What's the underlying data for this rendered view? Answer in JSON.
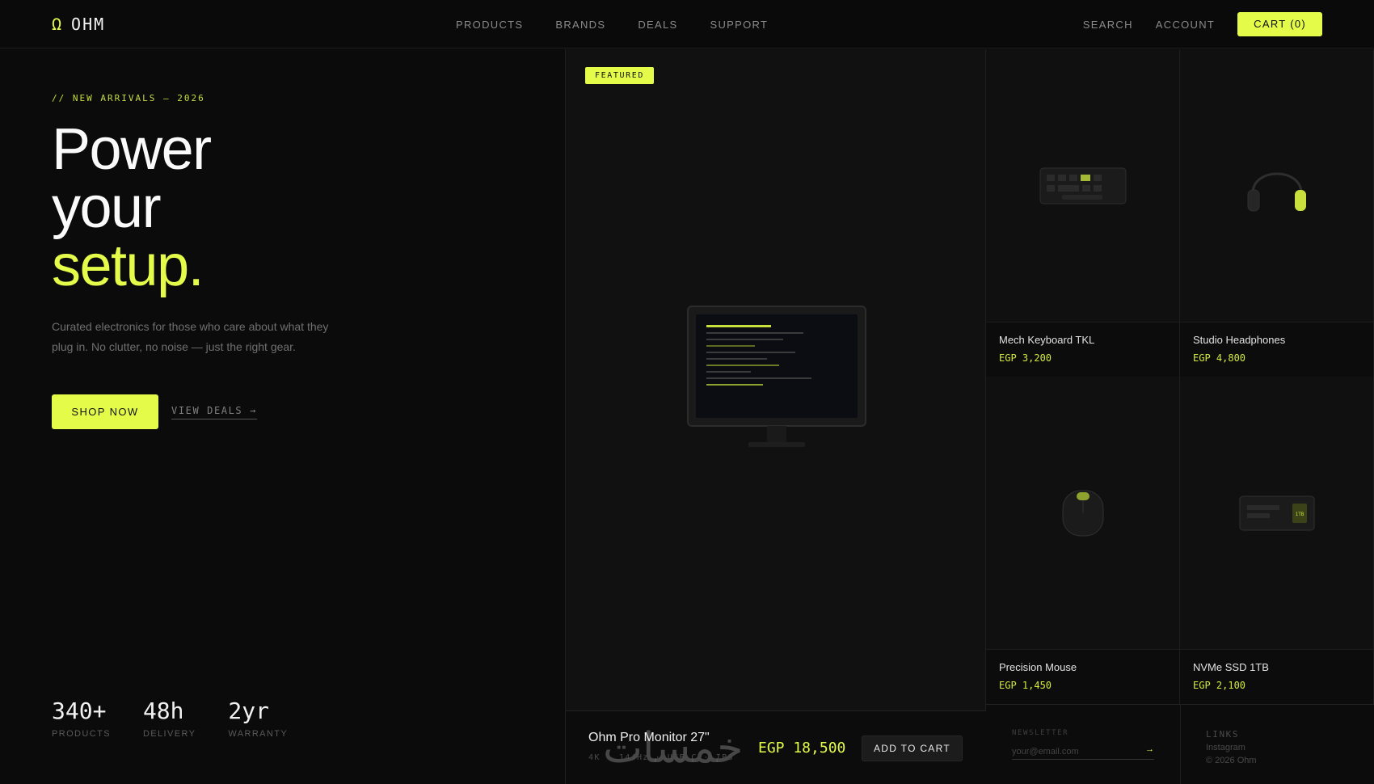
{
  "brand": {
    "symbol": "Ω",
    "name": "OHM"
  },
  "nav": {
    "links": [
      "PRODUCTS",
      "BRANDS",
      "DEALS",
      "SUPPORT"
    ],
    "search": "SEARCH",
    "account": "ACCOUNT",
    "cart": "CART (0)"
  },
  "hero": {
    "eyebrow": "// NEW ARRIVALS — 2026",
    "headline": [
      "Power",
      "your",
      "setup."
    ],
    "lede": "Curated electronics for those who care about what they plug in. No clutter, no noise — just the right gear.",
    "shop_label": "SHOP NOW",
    "deals_label": "VIEW DEALS →",
    "stats": [
      {
        "value": "340+",
        "label": "PRODUCTS"
      },
      {
        "value": "48h",
        "label": "DELIVERY"
      },
      {
        "value": "2yr",
        "label": "WARRANTY"
      }
    ]
  },
  "featured": {
    "badge": "FEATURED",
    "name": "Ohm Pro Monitor 27\"",
    "specs": [
      "4K",
      "·",
      "144Hz",
      "·",
      "USB-C",
      "·",
      "IPS"
    ],
    "price": "EGP 18,500",
    "add_label": "ADD TO CART",
    "watermark": "خمسات"
  },
  "products": [
    {
      "name": "Mech Keyboard TKL",
      "price": "EGP 3,200",
      "icon": "keyboard-icon"
    },
    {
      "name": "Studio Headphones",
      "price": "EGP 4,800",
      "icon": "headphones-icon"
    },
    {
      "name": "Precision Mouse",
      "price": "EGP 1,450",
      "icon": "mouse-icon"
    },
    {
      "name": "NVMe SSD 1TB",
      "price": "EGP 2,100",
      "icon": "ssd-icon",
      "ssd_tag": "1TB"
    }
  ],
  "footer": {
    "newsletter_label": "NEWSLETTER",
    "newsletter_placeholder": "your@email.com",
    "newsletter_go": "→",
    "links_label": "LINKS",
    "links": [
      "Instagram",
      "© 2026 Ohm"
    ]
  },
  "colors": {
    "accent": "#e4fb4a",
    "bg": "#0b0b0b",
    "panel": "#111111"
  }
}
